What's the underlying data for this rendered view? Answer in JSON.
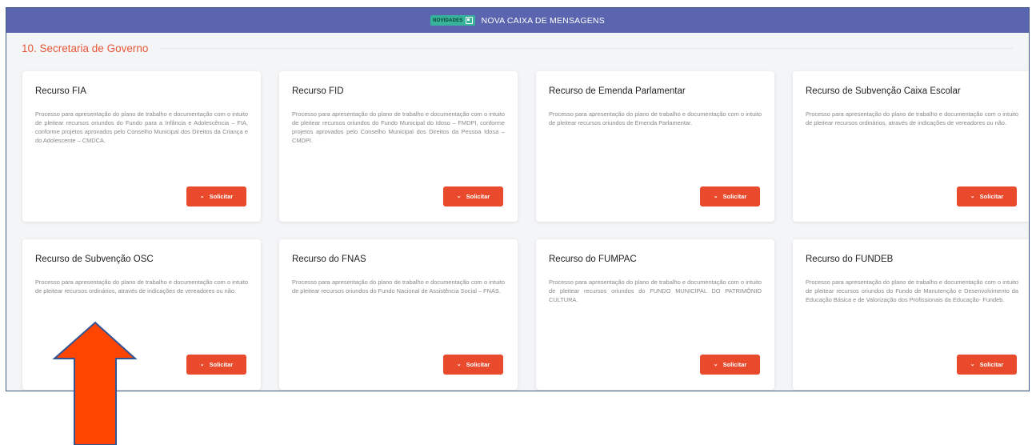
{
  "banner": {
    "badge": "NOVIDADES",
    "title": "NOVA CAIXA DE MENSAGENS"
  },
  "section": {
    "title": "10. Secretaria de Governo"
  },
  "button_label": "Solicitar",
  "cards": [
    {
      "title": "Recurso FIA",
      "description": "Processo para apresentação do plano de trabalho e documentação com o intuito de pleitear recursos oriundos do Fundo para a Infância e Adolescência – FIA, conforme projetos aprovados pelo Conselho Municipal dos Direitos da Criança e do Adolescente – CMDCA."
    },
    {
      "title": "Recurso FID",
      "description": "Processo para apresentação do plano de trabalho e documentação com o intuito de pleitear recursos oriundos do Fundo Municipal do Idoso – FMDPI, conforme projetos aprovados pelo Conselho Municipal dos Direitos da Pessoa Idosa – CMDPI."
    },
    {
      "title": "Recurso de Emenda Parlamentar",
      "description": "Processo para apresentação do plano de trabalho e documentação com o intuito de pleitear recursos oriundos de Emenda Parlamentar."
    },
    {
      "title": "Recurso de Subvenção Caixa Escolar",
      "description": "Processo para apresentação do plano de trabalho e documentação com o intuito de pleitear recursos ordinários, através de indicações de vereadores ou não."
    },
    {
      "title": "Recurso de Subvenção OSC",
      "description": "Processo para apresentação do plano de trabalho e documentação com o intuito de pleitear recursos ordinários, através de indicações de vereadores ou não."
    },
    {
      "title": "Recurso do FNAS",
      "description": "Processo para apresentação do plano de trabalho e documentação com o intuito de pleitear recursos oriundos do Fundo Nacional de Assistência Social – FNAS."
    },
    {
      "title": "Recurso do FUMPAC",
      "description": "Processo para apresentação do plano de trabalho e documentação com o intuito de pleitear recursos oriundos do FUNDO MUNICIPAL DO PATRIMÔNIO CULTURA."
    },
    {
      "title": "Recurso do FUNDEB",
      "description": "Processo para apresentação do plano de trabalho e documentação com o intuito de pleitear recursos oriundos do Fundo de Manutenção e Desenvolvimento da Educação Básica e de Valorização dos Profissionais da Educação- Fundeb."
    }
  ],
  "colors": {
    "banner": "#5b64ae",
    "accent": "#e84a2b",
    "section_title": "#e8573a",
    "annotation_arrow": "#ff4500",
    "annotation_outline": "#2f5597"
  },
  "icons": {
    "banner_badge": "message-box-icon",
    "button": "chevron-down-icon",
    "annotation": "up-arrow-annotation"
  }
}
